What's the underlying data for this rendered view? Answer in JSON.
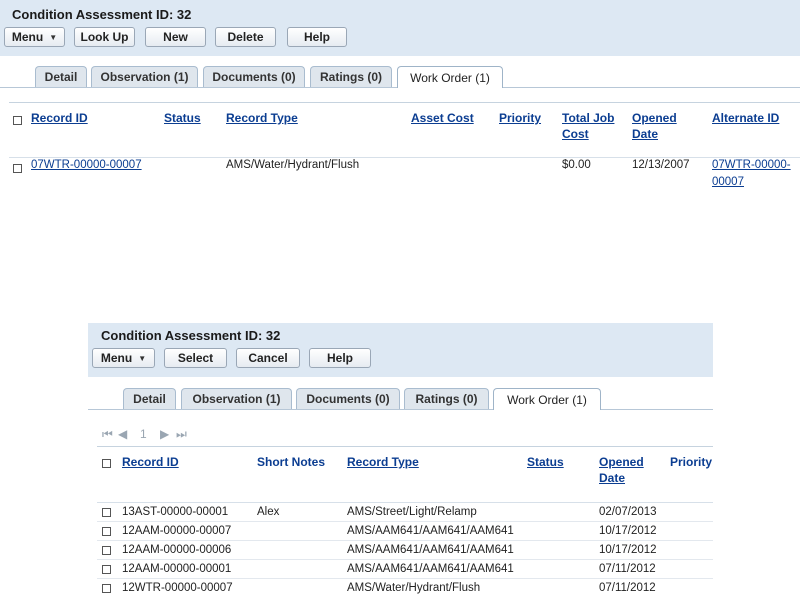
{
  "top": {
    "title": "Condition Assessment ID: 32",
    "buttons": {
      "menu": "Menu",
      "lookup": "Look Up",
      "new": "New",
      "delete": "Delete",
      "help": "Help"
    },
    "tabs": [
      "Detail",
      "Observation (1)",
      "Documents (0)",
      "Ratings (0)",
      "Work Order (1)"
    ],
    "columns": {
      "record_id": "Record ID",
      "status": "Status",
      "record_type": "Record Type",
      "asset_cost": "Asset Cost",
      "priority": "Priority",
      "total_job_cost_1": "Total Job",
      "total_job_cost_2": "Cost",
      "opened_date_1": "Opened",
      "opened_date_2": "Date",
      "alternate_id": "Alternate ID"
    },
    "rows": [
      {
        "record_id": "07WTR-00000-00007",
        "status": "",
        "record_type": "AMS/Water/Hydrant/Flush",
        "asset_cost": "",
        "priority": "",
        "total_job_cost": "$0.00",
        "opened_date": "12/13/2007",
        "alternate_id_1": "07WTR-00000-",
        "alternate_id_2": "00007"
      }
    ]
  },
  "bottom": {
    "title": "Condition Assessment ID: 32",
    "buttons": {
      "menu": "Menu",
      "select": "Select",
      "cancel": "Cancel",
      "help": "Help"
    },
    "tabs": [
      "Detail",
      "Observation (1)",
      "Documents (0)",
      "Ratings (0)",
      "Work Order (1)"
    ],
    "pager": {
      "page": "1"
    },
    "columns": {
      "record_id": "Record ID",
      "short_notes": "Short Notes",
      "record_type": "Record Type",
      "status": "Status",
      "opened_date_1": "Opened",
      "opened_date_2": "Date",
      "priority": "Priority"
    },
    "rows": [
      {
        "record_id": "13AST-00000-00001",
        "short_notes": "Alex",
        "record_type": "AMS/Street/Light/Relamp",
        "opened_date": "02/07/2013"
      },
      {
        "record_id": "12AAM-00000-00007",
        "short_notes": "",
        "record_type": "AMS/AAM641/AAM641/AAM641",
        "opened_date": "10/17/2012"
      },
      {
        "record_id": "12AAM-00000-00006",
        "short_notes": "",
        "record_type": "AMS/AAM641/AAM641/AAM641",
        "opened_date": "10/17/2012"
      },
      {
        "record_id": "12AAM-00000-00001",
        "short_notes": "",
        "record_type": "AMS/AAM641/AAM641/AAM641",
        "opened_date": "07/11/2012"
      },
      {
        "record_id": "12WTR-00000-00007",
        "short_notes": "",
        "record_type": "AMS/Water/Hydrant/Flush",
        "opened_date": "07/11/2012"
      }
    ]
  }
}
